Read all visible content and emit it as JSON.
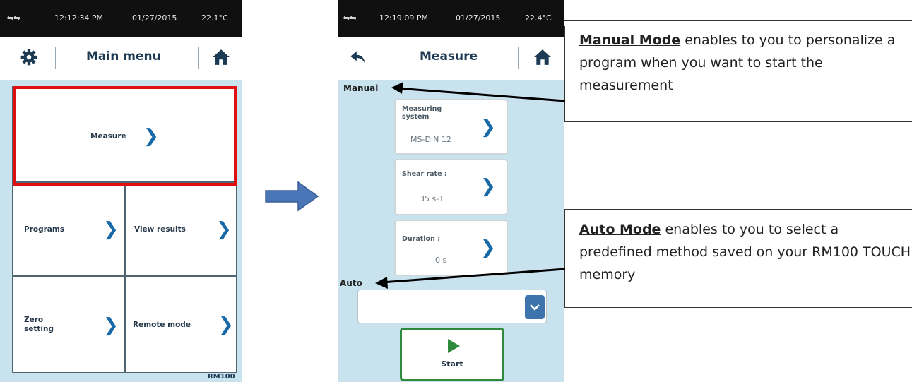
{
  "left_screen": {
    "status": {
      "usb_icons": "⇋⇋",
      "time": "12:12:34 PM",
      "date": "01/27/2015",
      "temp": "22.1°C"
    },
    "header": {
      "title": "Main menu"
    },
    "tiles": {
      "measure": "Measure",
      "programs": "Programs",
      "view_results": "View results",
      "zero_setting_1": "Zero",
      "zero_setting_2": "setting",
      "remote_mode": "Remote mode"
    },
    "model": "RM100",
    "chevron": "❯",
    "highlight_color": "#e01010"
  },
  "arrow_color": "#4a76b8",
  "right_screen": {
    "status": {
      "usb_icons": "⇋⇋",
      "time": "12:19:09 PM",
      "date": "01/27/2015",
      "temp": "22.4°C"
    },
    "header": {
      "title": "Measure"
    },
    "manual_label": "Manual",
    "cards": {
      "measuring_system_label_1": "Measuring",
      "measuring_system_label_2": "system",
      "measuring_system_value": "MS-DIN 12",
      "shear_rate_label": "Shear rate :",
      "shear_rate_value": "35 s-1",
      "duration_label": "Duration :",
      "duration_value": "0 s"
    },
    "auto_label": "Auto",
    "start_label": "Start",
    "chevron": "❯",
    "dropdown_chevron": "⌄"
  },
  "notes": {
    "manual": {
      "title": "Manual Mode",
      "text": " enables to you to personalize a program when you want to start the measurement"
    },
    "auto": {
      "title": "Auto Mode",
      "text": " enables to you to select a predefined method saved on your RM100 TOUCH memory"
    }
  }
}
